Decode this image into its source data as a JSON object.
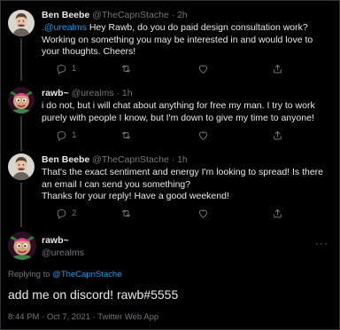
{
  "tweets": [
    {
      "name": "Ben Beebe",
      "handle": "@TheCapnStache",
      "sep": " · ",
      "time": "2h",
      "mention": ".@urealms",
      "text1": " Hey Rawb, do you do paid design consultation work? Working on something you may be interested in and would love to your thoughts. Cheers!",
      "replies": "1"
    },
    {
      "name": "rawb~",
      "handle": "@urealms",
      "sep": " · ",
      "time": "1h",
      "text1": "i do not, but i will chat about anything for free my man. I try to work purely with people I know, but I'm down to give my time to anyone!",
      "replies": "1"
    },
    {
      "name": "Ben Beebe",
      "handle": "@TheCapnStache",
      "sep": " · ",
      "time": "1h",
      "text1": "That's the exact sentiment and energy I'm looking to spread! Is there an email I can send you something?",
      "text2": "Thanks for your reply! Have a good weekend!",
      "replies": "2"
    }
  ],
  "main": {
    "name": "rawb~",
    "handle": "@urealms",
    "replying_prefix": "Replying to ",
    "replying_handle": "@TheCapnStache",
    "text": "add me on discord! rawb#5555",
    "timestamp": "8:44 PM · Oct 7, 2021 · Twitter Web App"
  },
  "colors": {
    "background": "#000000",
    "text": "#e7e9ea",
    "muted": "#71767b",
    "accent": "#1d9bf0"
  },
  "icons": [
    "reply-icon",
    "retweet-icon",
    "like-icon",
    "share-icon",
    "more-icon"
  ]
}
